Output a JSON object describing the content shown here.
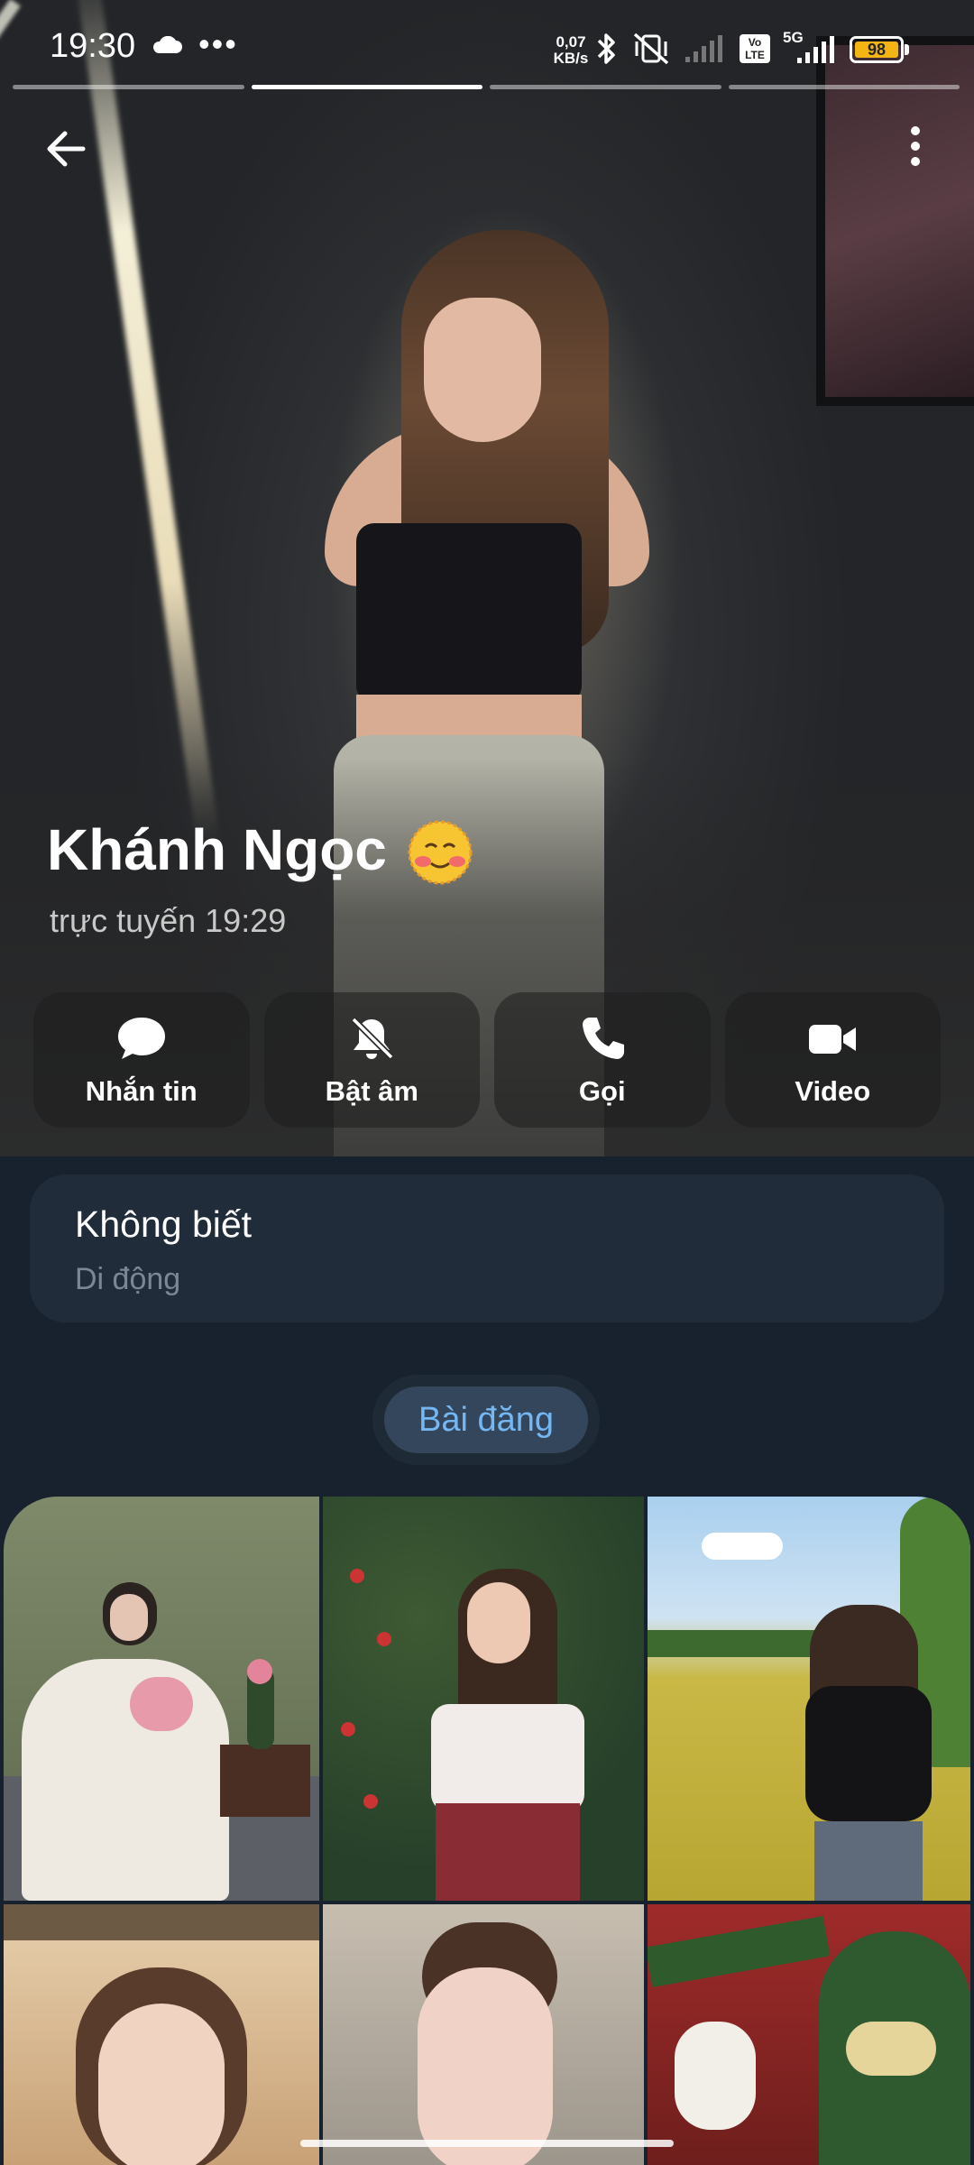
{
  "status_bar": {
    "time": "19:30",
    "dots": "•••",
    "net_speed_value": "0,07",
    "net_speed_unit": "KB/s",
    "volte": "Vo LTE",
    "network": "5G",
    "battery": "98",
    "icons": [
      "cloud-icon",
      "bluetooth-icon",
      "vibrate-off-icon",
      "signal-icon",
      "volte-icon",
      "signal-5g-icon",
      "battery-icon"
    ]
  },
  "story": {
    "segments": 4,
    "active_index": 1
  },
  "profile": {
    "name": "Khánh Ngọc",
    "status": "trực tuyến 19:29"
  },
  "actions": [
    {
      "label": "Nhắn tin",
      "icon": "message-icon"
    },
    {
      "label": "Bật âm",
      "icon": "bell-off-icon"
    },
    {
      "label": "Gọi",
      "icon": "phone-icon"
    },
    {
      "label": "Video",
      "icon": "video-icon"
    }
  ],
  "info": {
    "value": "Không biết",
    "label": "Di động"
  },
  "tabs": {
    "posts": "Bài đăng"
  },
  "colors": {
    "background": "#18222f",
    "card": "#212c3a",
    "accent": "#74b7f3",
    "battery": "#f3b514"
  }
}
